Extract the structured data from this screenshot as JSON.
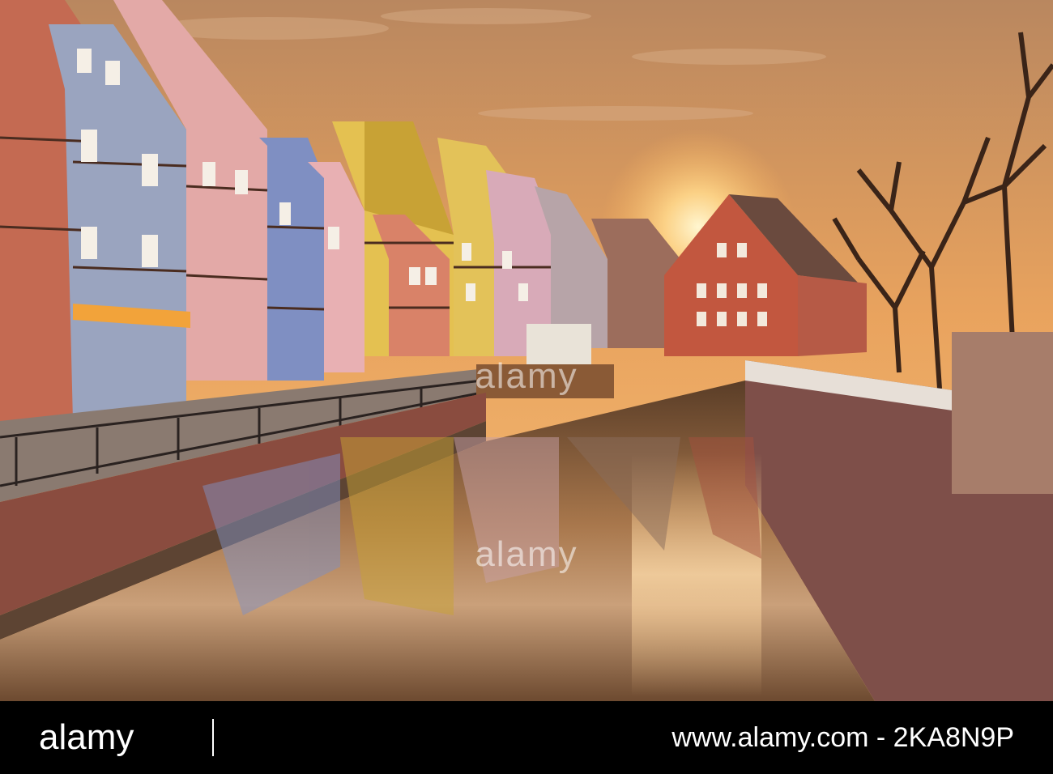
{
  "photo": {
    "subject": "half-timbered houses along a canal at sunset",
    "watermark_text": "alamy",
    "palette": {
      "sky_top": "#c98a5a",
      "sky_glow": "#f7b25a",
      "sun": "#fff3c4",
      "water": "#6b4a2e",
      "wall": "#8e5b4b"
    }
  },
  "footer": {
    "brand": "alamy",
    "image_id": "www.alamy.com - 2KA8N9P"
  }
}
